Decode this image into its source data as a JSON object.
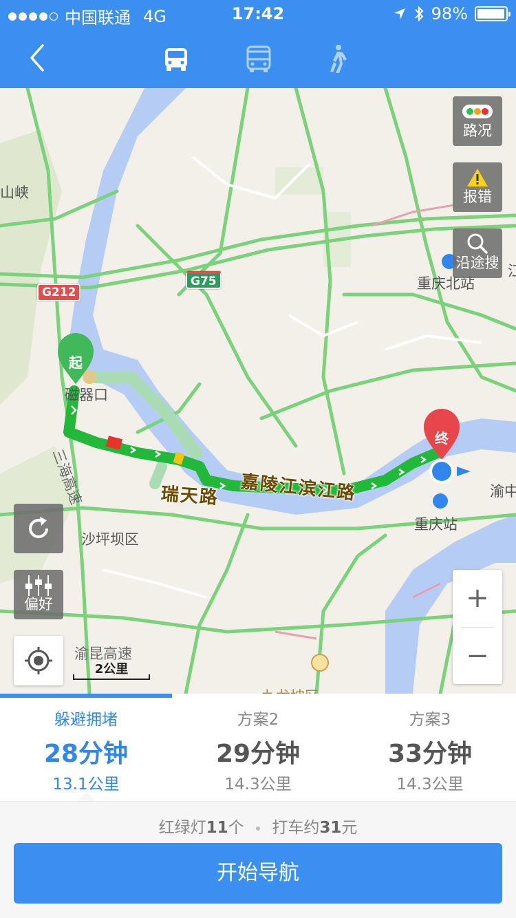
{
  "status_bar": {
    "carrier": "中国联通",
    "network": "4G",
    "time": "17:42",
    "battery": "98%",
    "battery_level": 0.98
  },
  "nav": {
    "modes": [
      "car-icon",
      "bus-icon",
      "walk-icon"
    ],
    "active_mode": "car"
  },
  "map": {
    "place_labels": {
      "shanxia": "山峡",
      "ciqikou": "磁器口",
      "shapingba": "沙坪坝区",
      "chongqing_north": "重庆北站",
      "chongqing_station": "重庆站",
      "yuzhong": "渝中",
      "jiu": "九龙坡区",
      "edge": "江"
    },
    "road_labels": {
      "ruitian": "瑞天路",
      "jialing": "嘉陵江滨江路",
      "sanhai": "三海高速",
      "yukun": "渝昆高速"
    },
    "shields": {
      "g212": "G212",
      "g75": "G75"
    },
    "start_marker": "起",
    "end_marker": "终",
    "scale": "2公里",
    "buttons": {
      "traffic": "路况",
      "report": "报错",
      "search_along": "沿途搜",
      "preference": "偏好",
      "zoom_in": "+",
      "zoom_out": "−"
    },
    "colors": {
      "route_green": "#22b83a",
      "route_red": "#e8322a",
      "route_yellow": "#f1c40f",
      "road_green": "#7ad27a"
    }
  },
  "route_options": [
    {
      "name": "躲避拥堵",
      "time": "28分钟",
      "distance": "13.1公里"
    },
    {
      "name": "方案2",
      "time": "29分钟",
      "distance": "14.3公里"
    },
    {
      "name": "方案3",
      "time": "33分钟",
      "distance": "14.3公里"
    }
  ],
  "summary": {
    "lights_prefix": "红绿灯",
    "lights_count": "11",
    "lights_suffix": "个",
    "taxi_prefix": "打车约",
    "taxi_amount": "31",
    "taxi_suffix": "元"
  },
  "start_button": "开始导航"
}
